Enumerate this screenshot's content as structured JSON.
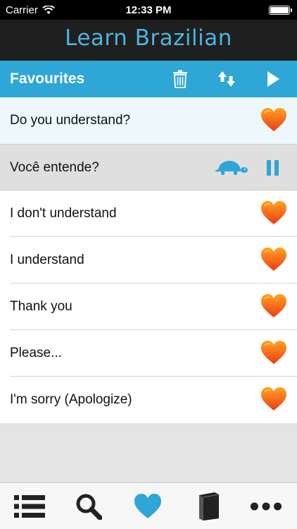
{
  "status": {
    "carrier": "Carrier",
    "time": "12:33 PM"
  },
  "app": {
    "title": "Learn Brazilian"
  },
  "toolbar": {
    "label": "Favourites"
  },
  "selected_phrase": {
    "text": "Do you understand?"
  },
  "translation": {
    "text": "Você entende?"
  },
  "phrases": [
    {
      "text": "I don't understand"
    },
    {
      "text": "I understand"
    },
    {
      "text": "Thank you"
    },
    {
      "text": "Please..."
    },
    {
      "text": "I'm sorry (Apologize)"
    }
  ],
  "colors": {
    "accent": "#2ea6d6",
    "title": "#4ab4de",
    "heart_top": "#ff9a1e",
    "heart_bottom": "#f0401a"
  },
  "tabs": [
    {
      "icon": "list-icon"
    },
    {
      "icon": "search-icon"
    },
    {
      "icon": "heart-icon",
      "active": true
    },
    {
      "icon": "book-icon"
    },
    {
      "icon": "more-icon"
    }
  ]
}
